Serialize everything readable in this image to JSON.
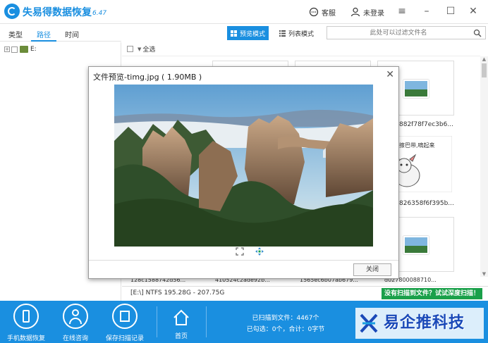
{
  "app": {
    "title": "失易得数据恢复",
    "version": "6.47"
  },
  "titlebar": {
    "service_label": "客服",
    "login_label": "未登录"
  },
  "left_tabs": [
    {
      "label": "类型"
    },
    {
      "label": "路径"
    },
    {
      "label": "时间"
    }
  ],
  "tree": {
    "drive_label": "E:"
  },
  "toolbar": {
    "preview_mode": "预览模式",
    "list_mode": "列表模式",
    "search_placeholder": "此处可以过滤文件名"
  },
  "select_all": "全选",
  "thumbnails": {
    "labels": [
      "882f78f7ec3b6...",
      "826358f6f395b...",
      "d027800088710..."
    ],
    "cartoon_text": "擦巴带,嘀起来"
  },
  "bottom_files": [
    "128c1588742d56...",
    "410524c2ade92b...",
    "1565ec6b07ab679...",
    "d027800088710..."
  ],
  "status": {
    "drive_info": "[E:\\] NTFS 195.28G - 207.75G",
    "deep_scan": "没有扫描到文件？试试深度扫描！"
  },
  "footer": {
    "buttons": [
      {
        "label": "手机数据恢复"
      },
      {
        "label": "在线咨询"
      },
      {
        "label": "保存扫描记录"
      }
    ],
    "home": "首页",
    "scanned": "已扫描到文件：4467个",
    "checked": "已勾选：0个，合计：0字节"
  },
  "watermark": {
    "text": "易企推科技"
  },
  "dialog": {
    "title": "文件预览-timg.jpg ( 1.90MB )",
    "close_button": "关闭"
  },
  "colors": {
    "primary": "#1a8fe0",
    "green": "#1aa04a"
  }
}
